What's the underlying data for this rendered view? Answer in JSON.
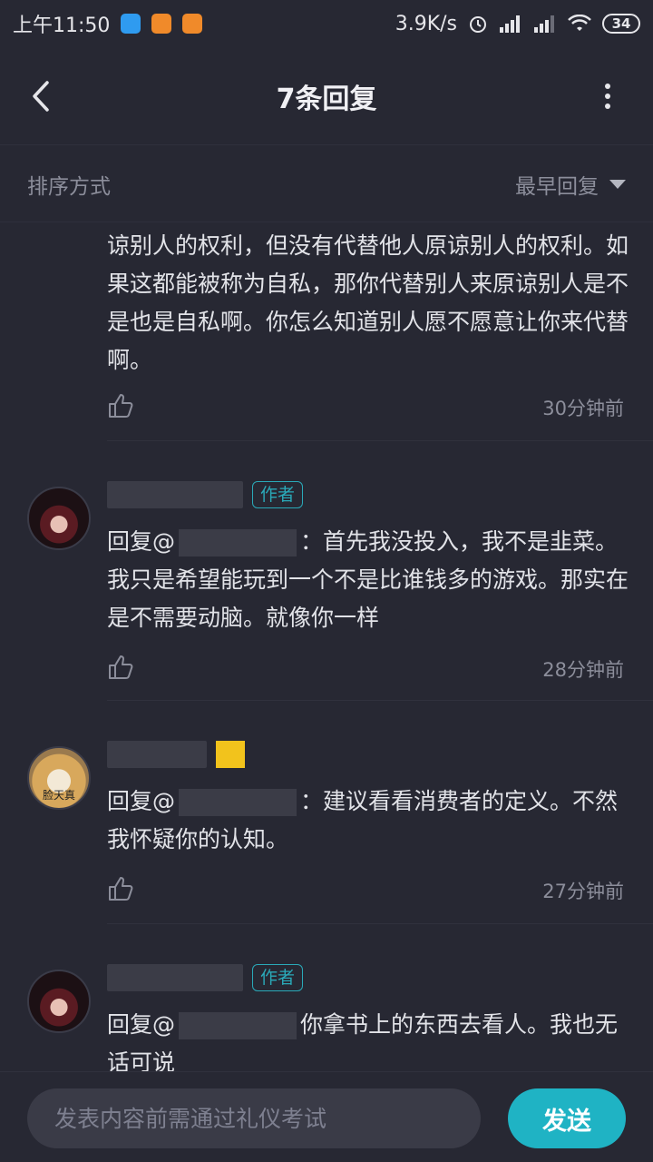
{
  "status_bar": {
    "time": "上午11:50",
    "network_speed": "3.9K/s",
    "battery": "34"
  },
  "header": {
    "title": "7条回复"
  },
  "sort": {
    "label": "排序方式",
    "selected": "最早回复"
  },
  "comments": [
    {
      "text": "谅别人的权利，但没有代替他人原谅别人的权利。如果这都能被称为自私，那你代替别人来原谅别人是不是也是自私啊。你怎么知道别人愿不愿意让你来代替啊。",
      "time": "30分钟前"
    },
    {
      "author_badge": "作者",
      "reply_prefix": "回复@",
      "text": "：首先我没投入，我不是韭菜。我只是希望能玩到一个不是比谁钱多的游戏。那实在是不需要动脑。就像你一样",
      "time": "28分钟前"
    },
    {
      "avatar_caption": "脸天真",
      "reply_prefix": "回复@",
      "text": "：建议看看消费者的定义。不然我怀疑你的认知。",
      "time": "27分钟前"
    },
    {
      "author_badge": "作者",
      "reply_prefix": "回复@",
      "text": "你拿书上的东西去看人。我也无话可说"
    }
  ],
  "input": {
    "placeholder": "发表内容前需通过礼仪考试",
    "send_label": "发送"
  },
  "colors": {
    "background": "#272833",
    "accent": "#1fb3c4",
    "author_badge": "#2aa9b8"
  }
}
